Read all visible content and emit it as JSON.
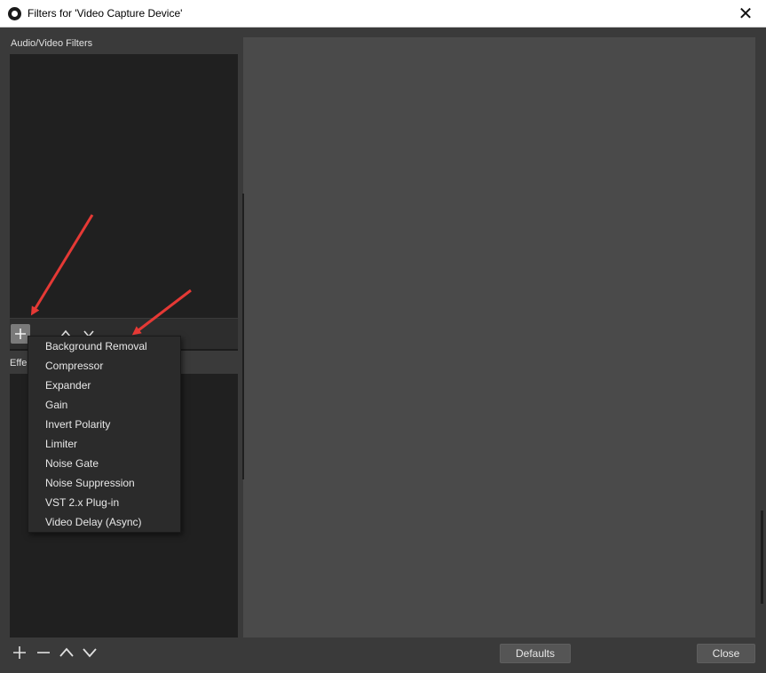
{
  "window": {
    "title": "Filters for 'Video Capture Device'",
    "close_glyph": "✕"
  },
  "left": {
    "av_filters_label": "Audio/Video Filters",
    "effect_filters_label": "Effe"
  },
  "toolbar_icons": {
    "add": "+",
    "remove": "−",
    "up": "^",
    "down": "v"
  },
  "context_menu": {
    "items": [
      "Background Removal",
      "Compressor",
      "Expander",
      "Gain",
      "Invert Polarity",
      "Limiter",
      "Noise Gate",
      "Noise Suppression",
      "VST 2.x Plug-in",
      "Video Delay (Async)"
    ]
  },
  "buttons": {
    "defaults": "Defaults",
    "close": "Close"
  },
  "colors": {
    "background": "#3a3a3a",
    "list_bg": "#202020",
    "preview_bg": "#4a4a4a",
    "annotation_arrow": "#e53935"
  },
  "icons": {
    "app": "obs-logo-icon",
    "close": "close-icon",
    "add": "plus-icon",
    "remove": "minus-icon",
    "up": "chevron-up-icon",
    "down": "chevron-down-icon"
  }
}
